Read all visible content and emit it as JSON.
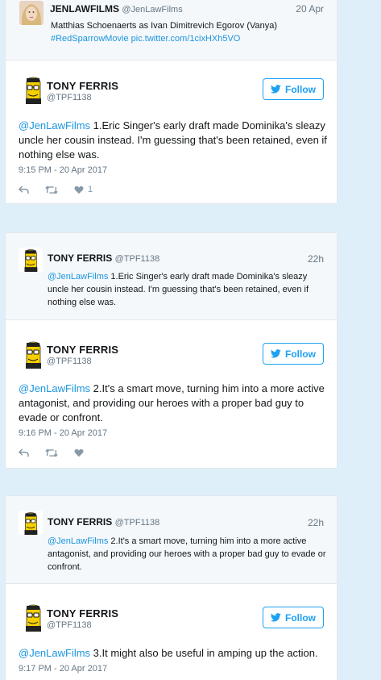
{
  "colors": {
    "link": "#1b95e0",
    "follow": "#1da1f2",
    "background": "#dfeff9"
  },
  "card1": {
    "quoted": {
      "name": "JENLAWFILMS",
      "handle": "@JenLawFilms",
      "time": "20 Apr",
      "text": "Matthias Schoenaerts as Ivan Dimitrevich Egorov (Vanya)",
      "link": "#RedSparrowMovie pic.twitter.com/1cixHXh5VO"
    },
    "name": "TONY FERRIS",
    "handle": "@TPF1138",
    "follow_label": "Follow",
    "mention": "@JenLawFilms",
    "text": " 1.Eric Singer's early draft made Dominika's sleazy uncle her cousin instead. I'm guessing that's been retained, even if nothing else was.",
    "timestamp": "9:15 PM - 20 Apr 2017",
    "like_count": "1"
  },
  "card2": {
    "quoted": {
      "name": "TONY FERRIS",
      "handle": "@TPF1138",
      "time": "22h",
      "mention": "@JenLawFilms",
      "text": " 1.Eric Singer's early draft made Dominika's sleazy uncle her cousin instead. I'm guessing that's been retained, even if nothing else was."
    },
    "name": "TONY FERRIS",
    "handle": "@TPF1138",
    "follow_label": "Follow",
    "mention": "@JenLawFilms",
    "text": " 2.It's a smart move, turning him into a more active antagonist, and providing our heroes with a proper bad guy to evade or confront.",
    "timestamp": "9:16 PM - 20 Apr 2017"
  },
  "card3": {
    "quoted": {
      "name": "TONY FERRIS",
      "handle": "@TPF1138",
      "time": "22h",
      "mention": "@JenLawFilms",
      "text": " 2.It's a smart move, turning him into a more active antagonist, and providing our heroes with a proper bad guy to evade or confront."
    },
    "name": "TONY FERRIS",
    "handle": "@TPF1138",
    "follow_label": "Follow",
    "mention": "@JenLawFilms",
    "text": " 3.It might also be useful in amping up the action.",
    "timestamp": "9:17 PM - 20 Apr 2017"
  }
}
